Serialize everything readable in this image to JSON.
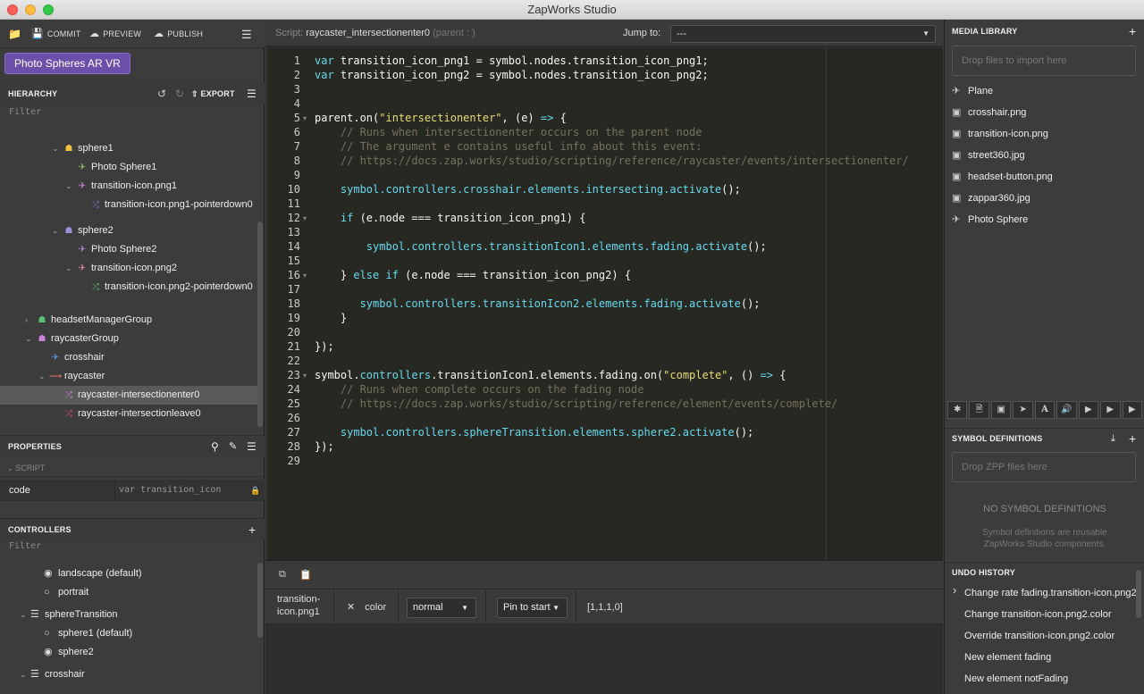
{
  "window": {
    "title": "ZapWorks Studio"
  },
  "toolbar": {
    "commit": "COMMIT",
    "preview": "PREVIEW",
    "publish": "PUBLISH"
  },
  "project": {
    "name": "Photo Spheres AR VR"
  },
  "hierarchy": {
    "title": "HIERARCHY",
    "export": "EXPORT",
    "filter_placeholder": "Filter",
    "items": [
      {
        "label": "sphere1",
        "icon": "group-icon",
        "color": "#f0c040"
      },
      {
        "label": "Photo Sphere1",
        "icon": "rocket-icon",
        "color": "#9bbf6a"
      },
      {
        "label": "transition-icon.png1",
        "icon": "rocket-icon",
        "color": "#c986d9"
      },
      {
        "label": "transition-icon.png1-pointerdown0",
        "icon": "shuffle-icon",
        "color": "#8a6fd9"
      },
      {
        "label": "sphere2",
        "icon": "group-icon",
        "color": "#9b8fd9"
      },
      {
        "label": "Photo Sphere2",
        "icon": "rocket-icon",
        "color": "#b58fe0"
      },
      {
        "label": "transition-icon.png2",
        "icon": "rocket-icon",
        "color": "#e08fa0"
      },
      {
        "label": "transition-icon.png2-pointerdown0",
        "icon": "shuffle-icon",
        "color": "#5cc07a"
      },
      {
        "label": "headsetManagerGroup",
        "icon": "group-icon",
        "color": "#5cc07a"
      },
      {
        "label": "raycasterGroup",
        "icon": "group-icon",
        "color": "#c986d9"
      },
      {
        "label": "crosshair",
        "icon": "rocket-icon",
        "color": "#5c9be0"
      },
      {
        "label": "raycaster",
        "icon": "arrow-icon",
        "color": "#e07070"
      },
      {
        "label": "raycaster-intersectionenter0",
        "icon": "shuffle-icon",
        "color": "#c986d9"
      },
      {
        "label": "raycaster-intersectionleave0",
        "icon": "shuffle-icon",
        "color": "#e05080"
      }
    ]
  },
  "properties": {
    "title": "PROPERTIES",
    "section": "SCRIPT",
    "field_label": "code",
    "field_value": "var transition_icon"
  },
  "controllers": {
    "title": "CONTROLLERS",
    "filter_placeholder": "Filter",
    "items": [
      {
        "label": "landscape (default)",
        "type": "radio",
        "checked": true
      },
      {
        "label": "portrait",
        "type": "radio",
        "checked": false
      },
      {
        "label": "sphereTransition",
        "type": "group"
      },
      {
        "label": "sphere1 (default)",
        "type": "radio",
        "checked": false
      },
      {
        "label": "sphere2",
        "type": "radio",
        "checked": true
      },
      {
        "label": "crosshair",
        "type": "group"
      }
    ]
  },
  "script": {
    "prefix": "Script:",
    "name": "raycaster_intersectionenter0",
    "parent": "(parent : )",
    "jump_label": "Jump to:",
    "jump_value": "---"
  },
  "code_lines": [
    "var transition_icon_png1 = symbol.nodes.transition_icon_png1;",
    "var transition_icon_png2 = symbol.nodes.transition_icon_png2;",
    "",
    "",
    "parent.on(\"intersectionenter\", (e) => {",
    "    // Runs when intersectionenter occurs on the parent node",
    "    // The argument e contains useful info about this event:",
    "    // https://docs.zap.works/studio/scripting/reference/raycaster/events/intersectionenter/",
    "",
    "    symbol.controllers.crosshair.elements.intersecting.activate();",
    "",
    "    if (e.node === transition_icon_png1) {",
    "",
    "        symbol.controllers.transitionIcon1.elements.fading.activate();",
    "",
    "    } else if (e.node === transition_icon_png2) {",
    "",
    "       symbol.controllers.transitionIcon2.elements.fading.activate();",
    "    }",
    "",
    "});",
    "",
    "symbol.controllers.transitionIcon1.elements.fading.on(\"complete\", () => {",
    "    // Runs when complete occurs on the fading node",
    "    // https://docs.zap.works/studio/scripting/reference/element/events/complete/",
    "",
    "    symbol.controllers.sphereTransition.elements.sphere2.activate();",
    "});",
    ""
  ],
  "timeline": {
    "node": "transition-icon.png1",
    "property": "color",
    "easing": "normal",
    "pin": "Pin to start",
    "value": "[1,1,1,0]"
  },
  "media_library": {
    "title": "MEDIA LIBRARY",
    "drop_hint": "Drop files to import here",
    "items": [
      {
        "label": "Plane",
        "icon": "rocket-icon"
      },
      {
        "label": "crosshair.png",
        "icon": "image-icon"
      },
      {
        "label": "transition-icon.png",
        "icon": "image-icon"
      },
      {
        "label": "street360.jpg",
        "icon": "image-icon"
      },
      {
        "label": "headset-button.png",
        "icon": "image-icon"
      },
      {
        "label": "zappar360.jpg",
        "icon": "image-icon"
      },
      {
        "label": "Photo Sphere",
        "icon": "rocket-icon"
      }
    ]
  },
  "symbol_definitions": {
    "title": "SYMBOL DEFINITIONS",
    "drop_hint": "Drop ZPP files here",
    "empty_title": "NO SYMBOL DEFINITIONS",
    "empty_desc_1": "Symbol definitions are reusable",
    "empty_desc_2": "ZapWorks Studio components."
  },
  "undo_history": {
    "title": "UNDO HISTORY",
    "items": [
      "Change rate fading.transition-icon.png2",
      "Change transition-icon.png2.color",
      "Override transition-icon.png2.color",
      "New element fading",
      "New element notFading"
    ]
  }
}
